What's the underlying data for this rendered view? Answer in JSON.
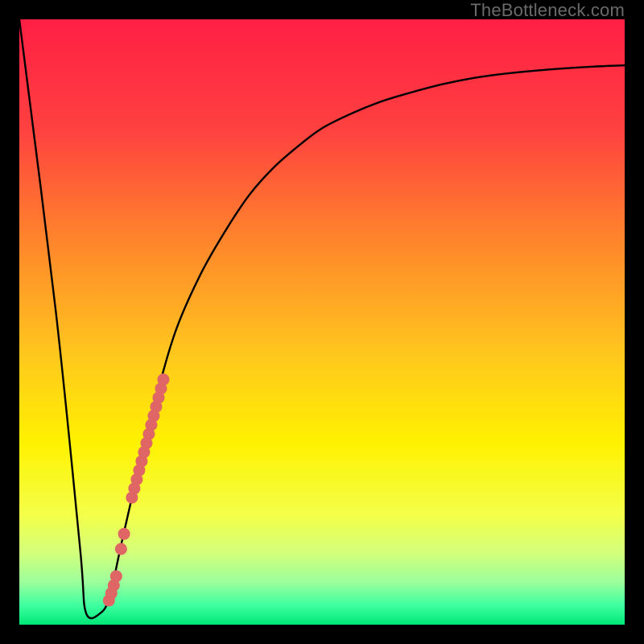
{
  "watermark": "TheBottleneck.com",
  "colors": {
    "gradient_stops": [
      {
        "offset": 0.0,
        "color": "#ff1f44"
      },
      {
        "offset": 0.18,
        "color": "#ff4040"
      },
      {
        "offset": 0.38,
        "color": "#ff8a2a"
      },
      {
        "offset": 0.55,
        "color": "#ffc61e"
      },
      {
        "offset": 0.7,
        "color": "#fff200"
      },
      {
        "offset": 0.82,
        "color": "#f3ff4a"
      },
      {
        "offset": 0.88,
        "color": "#d4ff7a"
      },
      {
        "offset": 0.93,
        "color": "#9cff9c"
      },
      {
        "offset": 0.97,
        "color": "#3affa0"
      },
      {
        "offset": 1.0,
        "color": "#00e676"
      }
    ],
    "curve": "#000000",
    "marker_fill": "#e06666",
    "marker_stroke": "#c05050",
    "frame": "#000000"
  },
  "chart_data": {
    "type": "line",
    "title": "",
    "xlabel": "",
    "ylabel": "",
    "xlim": [
      0,
      100
    ],
    "ylim": [
      0,
      100
    ],
    "grid": false,
    "legend": false,
    "curve": {
      "x": [
        0,
        6,
        10,
        11,
        13.5,
        15,
        17,
        20,
        23,
        26,
        30,
        34,
        38,
        42,
        46,
        50,
        55,
        60,
        65,
        70,
        75,
        80,
        85,
        90,
        95,
        100
      ],
      "y": [
        100,
        52,
        13,
        2,
        2,
        5,
        14,
        27,
        39,
        49,
        58,
        65,
        71,
        75.5,
        79,
        82,
        84.5,
        86.5,
        88,
        89.3,
        90.3,
        91.0,
        91.5,
        91.9,
        92.2,
        92.4
      ]
    },
    "markers": [
      {
        "x": 14.8,
        "y": 4.0
      },
      {
        "x": 15.2,
        "y": 5.2
      },
      {
        "x": 15.6,
        "y": 6.5
      },
      {
        "x": 16.0,
        "y": 8.0
      },
      {
        "x": 16.8,
        "y": 12.5
      },
      {
        "x": 17.3,
        "y": 15.0
      },
      {
        "x": 18.6,
        "y": 21.0
      },
      {
        "x": 19.0,
        "y": 22.5
      },
      {
        "x": 19.4,
        "y": 24.0
      },
      {
        "x": 19.8,
        "y": 25.5
      },
      {
        "x": 20.2,
        "y": 27.0
      },
      {
        "x": 20.6,
        "y": 28.5
      },
      {
        "x": 21.0,
        "y": 30.0
      },
      {
        "x": 21.4,
        "y": 31.5
      },
      {
        "x": 21.8,
        "y": 33.0
      },
      {
        "x": 22.2,
        "y": 34.5
      },
      {
        "x": 22.6,
        "y": 36.0
      },
      {
        "x": 23.0,
        "y": 37.5
      },
      {
        "x": 23.4,
        "y": 39.0
      },
      {
        "x": 23.8,
        "y": 40.5
      }
    ]
  }
}
